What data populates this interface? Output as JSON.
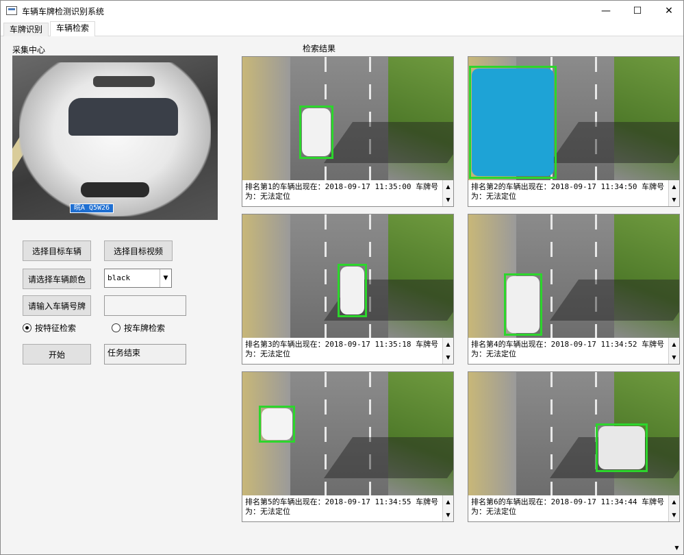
{
  "window": {
    "title": "车辆车牌检测识别系统",
    "controls": {
      "minimize": "—",
      "maximize": "☐",
      "close": "✕"
    }
  },
  "tabs": [
    {
      "label": "车牌识别",
      "active": false
    },
    {
      "label": "车辆检索",
      "active": true
    }
  ],
  "left_panel": {
    "capture_label": "采集中心",
    "plate_text": "皖A Q5W26",
    "buttons": {
      "select_vehicle": "选择目标车辆",
      "select_video": "选择目标视频",
      "select_color": "请选择车辆颜色",
      "input_plate": "请输入车辆号牌",
      "start": "开始"
    },
    "color_select": {
      "value": "black"
    },
    "plate_input": {
      "value": ""
    },
    "radios": {
      "by_feature": {
        "label": "按特征检索",
        "checked": true
      },
      "by_plate": {
        "label": "按车牌检索",
        "checked": false
      }
    },
    "status": "任务结束"
  },
  "results": {
    "label": "检索结果",
    "items": [
      {
        "caption": "排名第1的车辆出现在：2018-09-17 11:35:00 车牌号为：无法定位"
      },
      {
        "caption": "排名第2的车辆出现在：2018-09-17 11:34:50 车牌号为：无法定位"
      },
      {
        "caption": "排名第3的车辆出现在：2018-09-17 11:35:18 车牌号为：无法定位"
      },
      {
        "caption": "排名第4的车辆出现在：2018-09-17 11:34:52 车牌号为：无法定位"
      },
      {
        "caption": "排名第5的车辆出现在：2018-09-17 11:34:55 车牌号为：无法定位"
      },
      {
        "caption": "排名第6的车辆出现在：2018-09-17 11:34:44 车牌号为：无法定位"
      }
    ]
  },
  "colors": {
    "bbox": "#2cd62c",
    "plate_blue": "#1f6fd1"
  }
}
